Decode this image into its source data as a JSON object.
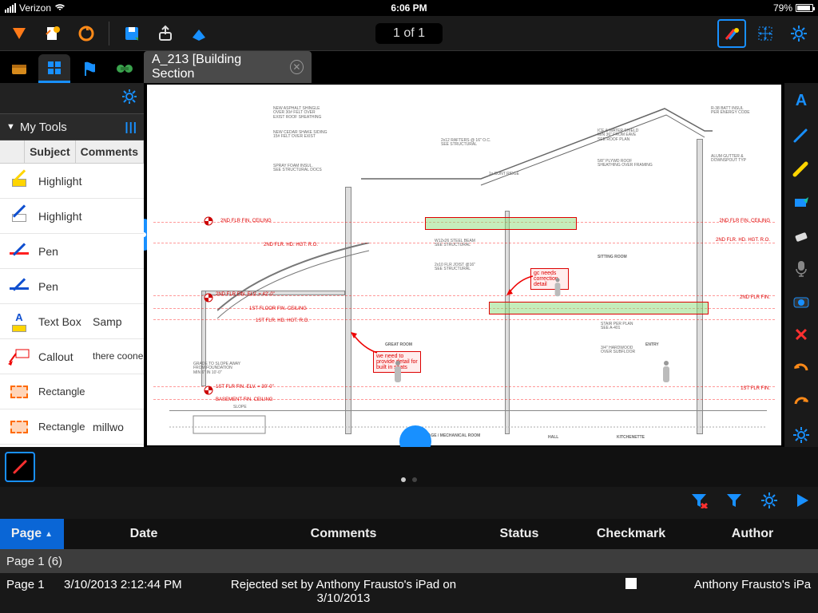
{
  "status_bar": {
    "carrier": "Verizon",
    "time": "6:06 PM",
    "battery_pct": "79%"
  },
  "top": {
    "page_indicator": "1 of 1"
  },
  "doc_tab": {
    "title": "A_213 [Building Section"
  },
  "left_panel": {
    "title": "My Tools",
    "columns": {
      "icon": "",
      "subject": "Subject",
      "comments": "Comments"
    },
    "rows": [
      {
        "subject": "Highlight",
        "comment": ""
      },
      {
        "subject": "Highlight",
        "comment": ""
      },
      {
        "subject": "Pen",
        "comment": ""
      },
      {
        "subject": "Pen",
        "comment": ""
      },
      {
        "subject": "Text Box",
        "comment": "Samp"
      },
      {
        "subject": "Callout",
        "comment": "there coone"
      },
      {
        "subject": "Rectangle",
        "comment": ""
      },
      {
        "subject": "Rectangle",
        "comment": "millwo"
      }
    ]
  },
  "drawing": {
    "notes": {
      "callout1": "we need to provide detail for built in seats",
      "callout2": "gc needs correction detail"
    },
    "elev_labels": {
      "l1": "2ND FLR FIN. CEILING",
      "l2": "2ND FLR. HD. HGT. R.O.",
      "l3": "2ND FLR FIN. ELV. = 42'-0\"",
      "l4": "1ST FLOOR FIN. CEILING",
      "l5": "1ST FLR. HD. HGT. R.O.",
      "l6": "1ST FLR FIN. ELV. = 30'-0\"",
      "l7": "BASEMENT FIN. CEILING",
      "r1": "2ND FLR FIN. CEILING",
      "r2": "2ND FLR. HD. HGT. R.O.",
      "r3": "2ND FLR FIN.",
      "r4": "1ST FLR FIN."
    },
    "rooms": {
      "great": "GREAT ROOM",
      "sitting": "SITTING ROOM",
      "entry": "ENTRY",
      "storage": "STORAGE / MECHANICAL ROOM",
      "hall": "HALL",
      "kitchen": "KITCHENETTE"
    }
  },
  "filter_bar": {},
  "list": {
    "headers": {
      "page": "Page",
      "date": "Date",
      "comments": "Comments",
      "status": "Status",
      "check": "Checkmark",
      "author": "Author"
    },
    "group": "Page 1 (6)",
    "row": {
      "page": "Page 1",
      "date": "3/10/2013 2:12:44 PM",
      "comments": "Rejected set by Anthony Frausto's iPad on 3/10/2013",
      "status": "",
      "author": "Anthony Frausto's iPa"
    }
  }
}
